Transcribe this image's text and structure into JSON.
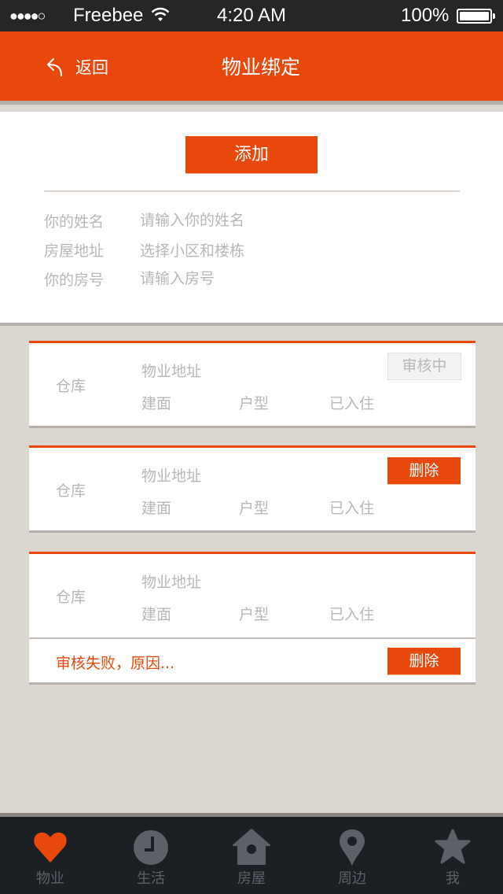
{
  "status_bar": {
    "signal": "●●●●○",
    "carrier": "Freebee",
    "time": "4:20 AM",
    "battery": "100%"
  },
  "nav": {
    "back_label": "返回",
    "title": "物业绑定"
  },
  "form": {
    "add_label": "添加",
    "fields": [
      {
        "label": "你的姓名",
        "placeholder": "请输入你的姓名",
        "value": ""
      },
      {
        "label": "房屋地址",
        "placeholder": "选择小区和楼栋",
        "value": ""
      },
      {
        "label": "你的房号",
        "placeholder": "请输入房号",
        "value": ""
      }
    ]
  },
  "cards": [
    {
      "name": "仓库",
      "address": "物业地址",
      "area": "建面",
      "layout": "户型",
      "occupancy": "已入住",
      "status": "审核中"
    },
    {
      "name": "仓库",
      "address": "物业地址",
      "area": "建面",
      "layout": "户型",
      "occupancy": "已入住",
      "action": "删除"
    },
    {
      "name": "仓库",
      "address": "物业地址",
      "area": "建面",
      "layout": "户型",
      "occupancy": "已入住",
      "fail_message": "审核失败，原因...",
      "action": "删除"
    }
  ],
  "tabs": [
    {
      "label": "物业",
      "icon": "heart-icon",
      "active": true
    },
    {
      "label": "生活",
      "icon": "clock-icon",
      "active": false
    },
    {
      "label": "房屋",
      "icon": "house-icon",
      "active": false
    },
    {
      "label": "周边",
      "icon": "location-pin-icon",
      "active": false
    },
    {
      "label": "我",
      "icon": "star-icon",
      "active": false
    }
  ],
  "colors": {
    "accent": "#e8480c",
    "tab_active": "#e8480c",
    "tab_inactive": "#5b6166",
    "tab_bar_bg": "#1c2025",
    "page_bg": "#dcd6d0"
  }
}
